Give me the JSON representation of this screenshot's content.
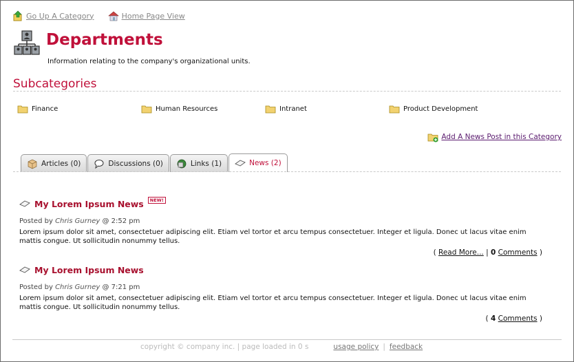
{
  "topnav": {
    "go_up": "Go Up A Category",
    "home_view": "Home Page View"
  },
  "header": {
    "title": "Departments",
    "subtitle": "Information relating to the company's organizational units."
  },
  "subcategories": {
    "heading": "Subcategories",
    "items": [
      "Finance",
      "Human Resources",
      "Intranet",
      "Product Development"
    ]
  },
  "actions": {
    "add_news": "Add A News Post in this Category"
  },
  "tabs": [
    {
      "label": "Articles (0)",
      "icon": "box-icon",
      "active": false
    },
    {
      "label": "Discussions (0)",
      "icon": "speech-bubble-icon",
      "active": false
    },
    {
      "label": "Links (1)",
      "icon": "link-icon",
      "active": false
    },
    {
      "label": "News (2)",
      "icon": "news-icon",
      "active": true
    }
  ],
  "posts": [
    {
      "title": "My Lorem Ipsum News",
      "badge": "NEW!",
      "posted_prefix": "Posted by",
      "author": "Chris Gurney",
      "time": "@ 2:52 pm",
      "body": "Lorem ipsum dolor sit amet, consectetuer adipiscing elit. Etiam vel tortor et arcu tempus consectetuer. Integer et ligula. Donec ut lacus vitae enim mattis congue. Ut sollicitudin nonummy tellus.",
      "read_more": "Read More...",
      "comment_count": "0",
      "comments_label": "Comments"
    },
    {
      "title": "My Lorem Ipsum News",
      "badge": "",
      "posted_prefix": "Posted by",
      "author": "Chris Gurney",
      "time": "@ 7:21 pm",
      "body": "Lorem ipsum dolor sit amet, consectetuer adipiscing elit. Etiam vel tortor et arcu tempus consectetuer. Integer et ligula. Donec ut lacus vitae enim mattis congue. Ut sollicitudin nonummy tellus.",
      "read_more": "",
      "comment_count": "4",
      "comments_label": "Comments"
    }
  ],
  "footer": {
    "copyright": "copyright © company inc. | page loaded in 0 s",
    "usage_policy": "usage policy",
    "separator": "|",
    "feedback": "feedback"
  },
  "colors": {
    "accent": "#c0103a",
    "folder": "#f2c94c"
  }
}
